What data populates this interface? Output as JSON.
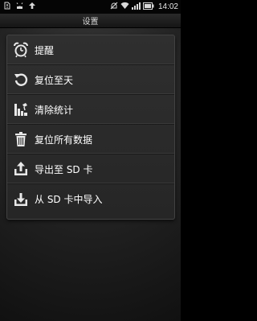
{
  "status_bar": {
    "time": "14:02",
    "icons": [
      "sim-warning-icon",
      "usb-debug-icon",
      "upload-icon",
      "mute-icon",
      "wifi-icon",
      "signal-icon",
      "battery-icon"
    ]
  },
  "title_bar": {
    "title": "设置"
  },
  "menu": {
    "items": [
      {
        "label": "提醒",
        "icon": "alarm-clock-icon"
      },
      {
        "label": "复位至天",
        "icon": "reset-arrow-icon"
      },
      {
        "label": "清除统计",
        "icon": "clear-chart-icon"
      },
      {
        "label": "复位所有数据",
        "icon": "trash-icon"
      },
      {
        "label": "导出至 SD 卡",
        "icon": "export-icon"
      },
      {
        "label": "从 SD 卡中导入",
        "icon": "import-icon"
      }
    ]
  }
}
